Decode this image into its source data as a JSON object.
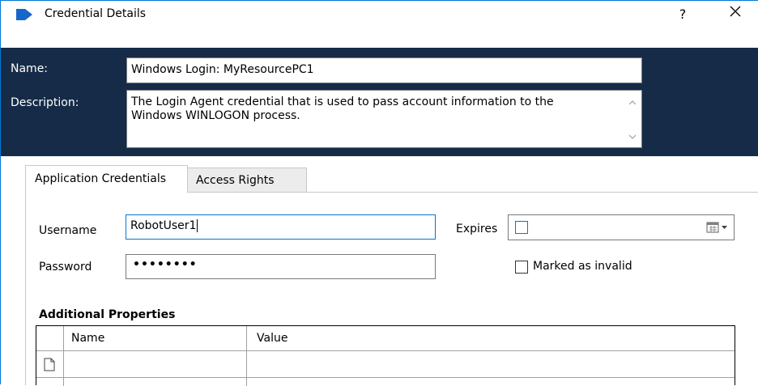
{
  "window": {
    "title": "Credential Details",
    "help_label": "?",
    "close_label": "✕",
    "accent": "#0078d7",
    "header_bg": "#152b48"
  },
  "header": {
    "name_label": "Name:",
    "name_value": "Windows Login: MyResourcePC1",
    "description_label": "Description:",
    "description_value": "The Login Agent credential that is used to pass account information to the Windows WINLOGON process."
  },
  "tabs": [
    {
      "label": "Application Credentials",
      "active": true
    },
    {
      "label": "Access Rights",
      "active": false
    }
  ],
  "form": {
    "username_label": "Username",
    "username_value": "RobotUser1",
    "password_label": "Password",
    "password_value": "••••••••",
    "expires_label": "Expires",
    "expires_checked": false,
    "marked_invalid_label": "Marked as invalid",
    "marked_invalid_checked": false
  },
  "properties": {
    "section_title": "Additional Properties",
    "columns": [
      "Name",
      "Value"
    ],
    "rows": []
  },
  "icons": [
    "app-logo-icon",
    "close-icon",
    "calendar-icon",
    "new-row-icon",
    "scroll-up-icon",
    "scroll-down-icon"
  ]
}
